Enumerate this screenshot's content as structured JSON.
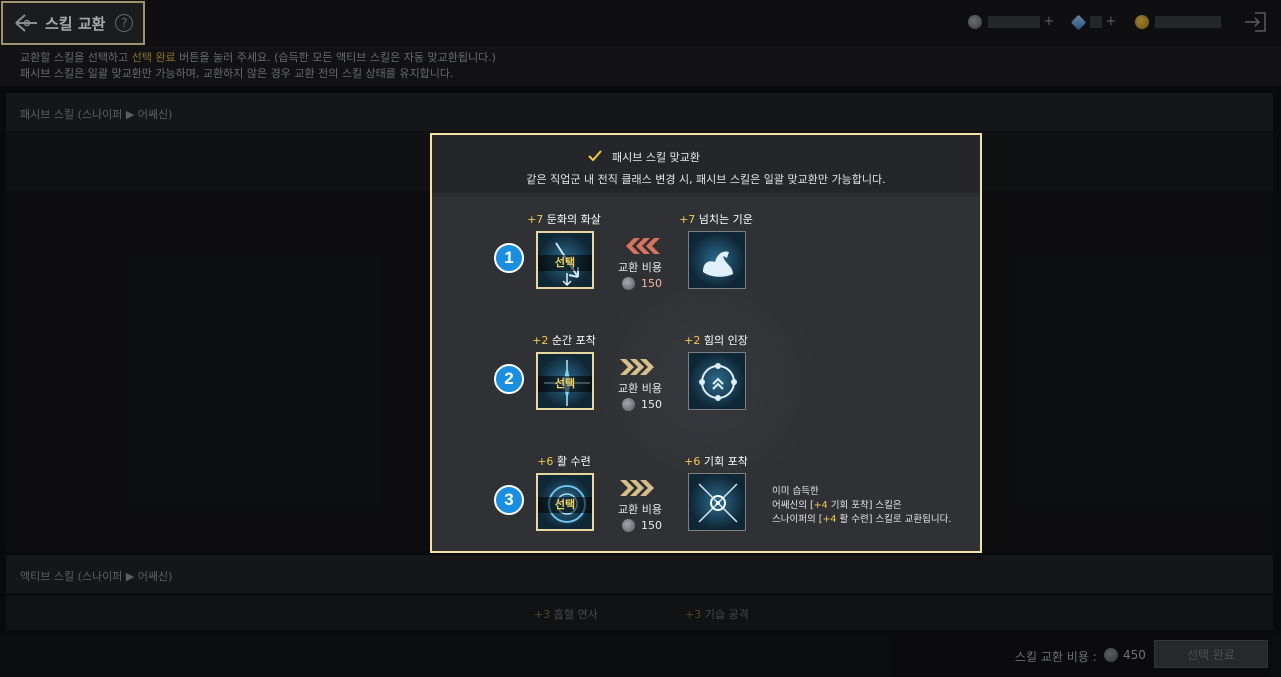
{
  "header": {
    "title": "스킬 교환",
    "help_icon": "question-circle-icon",
    "back_icon": "back-arrow-icon",
    "exit_icon": "exit-icon"
  },
  "info": {
    "line1_prefix": "교환할 스킬을 선택하고 ",
    "line1_highlight": "선택 완료",
    "line1_suffix": " 버튼을 눌러 주세요. (습득한 모든 액티브 스킬은 자동 맞교환됩니다.)",
    "line2": "패시브 스킬은 일괄 맞교환만 가능하며, 교환하지 않은 경우 교환 전의 스킬 상태를 유지합니다."
  },
  "sections": {
    "passive": "패시브 스킬 (스나이퍼 ▶ 어쌔신)",
    "active": "액티브 스킬 (스나이퍼 ▶ 어쌔신)"
  },
  "active_row": {
    "left_lv": "+3",
    "left_name": "흡혈 연사",
    "right_lv": "+3",
    "right_name": "기습 공격"
  },
  "popup": {
    "checkbox_label": "패시브 스킬 맞교환",
    "description": "같은 직업군 내 전직 클래스 변경 시, 패시브 스킬은 일괄 맞교환만 가능합니다.",
    "select_label": "선택",
    "cost_title": "교환 비용",
    "rows": [
      {
        "num": "1",
        "left_lv": "+7",
        "left_name": "둔화의 화살",
        "right_lv": "+7",
        "right_name": "넘치는 기운",
        "cost": "150",
        "arrow_color": "#d9735e"
      },
      {
        "num": "2",
        "left_lv": "+2",
        "left_name": "순간 포착",
        "right_lv": "+2",
        "right_name": "힘의 인장",
        "cost": "150",
        "arrow_color": "#d8c08a"
      },
      {
        "num": "3",
        "left_lv": "+6",
        "left_name": "활 수련",
        "right_lv": "+6",
        "right_name": "기회 포착",
        "cost": "150",
        "arrow_color": "#d8c08a"
      }
    ],
    "note": {
      "line1": "이미 습득한",
      "line2_a": "어쌔신의 [",
      "line2_lv": "+4",
      "line2_b": " 기회 포착] 스킬은",
      "line3_a": "스나이퍼의 [",
      "line3_lv": "+4",
      "line3_b": " 활 수련] 스킬로 교환됩니다."
    }
  },
  "footer": {
    "cost_label": "스킬 교환 비용 :",
    "cost_value": "450",
    "confirm_label": "선택 완료"
  },
  "colors": {
    "accent_border": "#f4e1a6",
    "level_gold": "#f2c94c",
    "number_badge": "#1a8ee0"
  }
}
